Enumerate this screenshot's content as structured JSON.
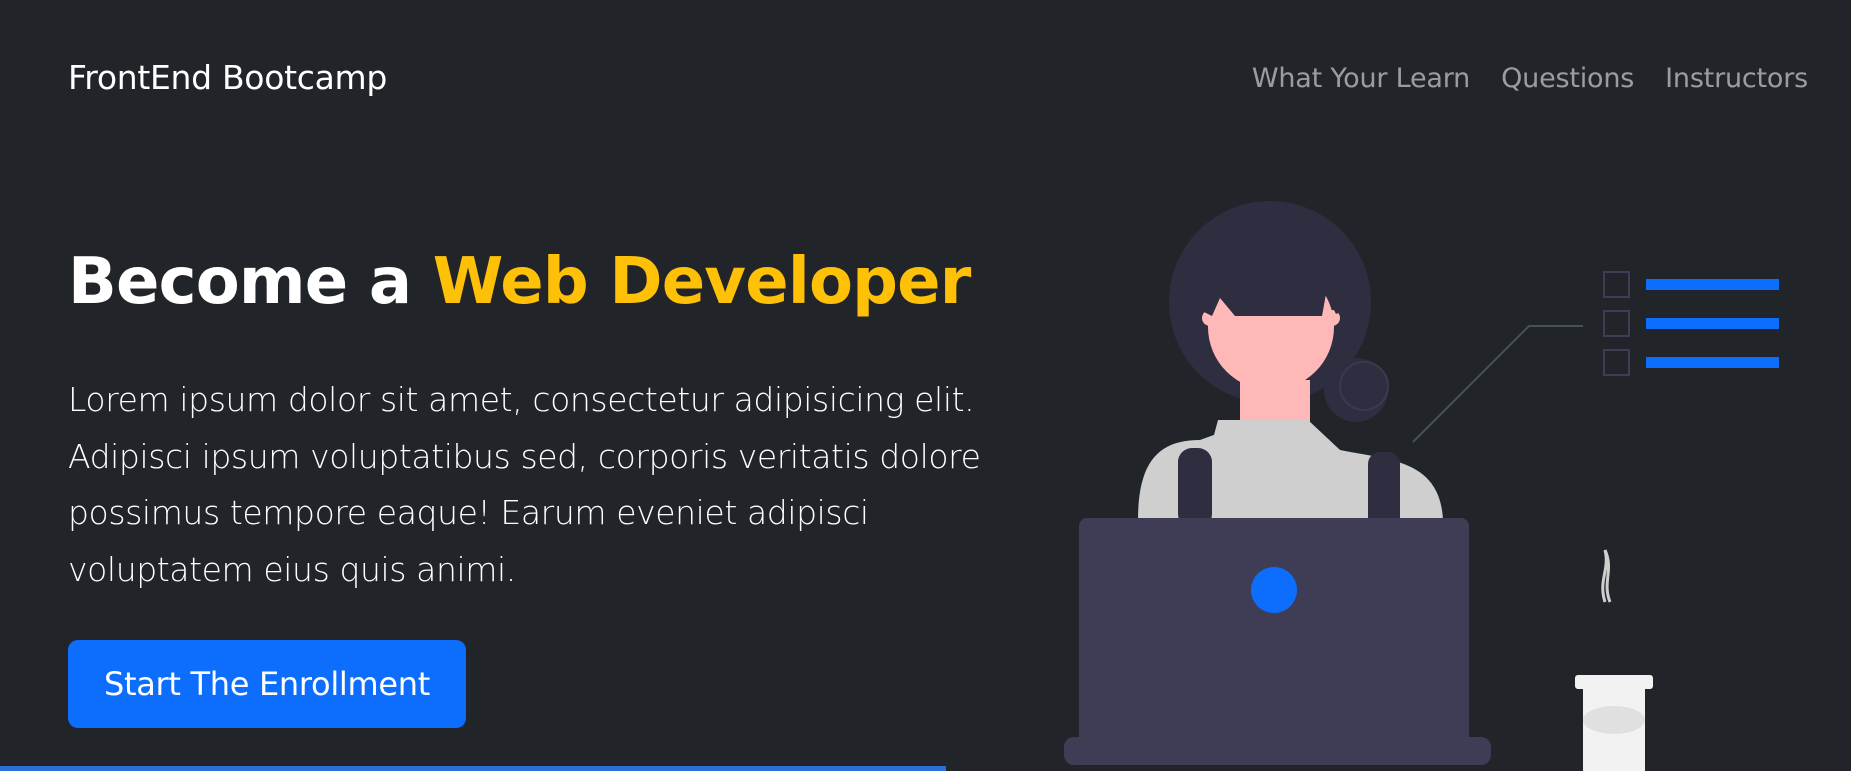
{
  "navbar": {
    "brand": "FrontEnd Bootcamp",
    "links": [
      {
        "label": "What Your Learn"
      },
      {
        "label": "Questions"
      },
      {
        "label": "Instructors"
      }
    ]
  },
  "hero": {
    "headline_start": "Become a ",
    "headline_highlight": "Web Developer",
    "lead_lines": [
      "Lorem ipsum dolor sit amet, consectetur adipisicing elit.",
      "Adipisci ipsum voluptatibus sed, corporis veritatis dolore",
      "possimus tempore eaque! Earum eveniet adipisci",
      "voluptatem eius quis animi."
    ],
    "cta_label": "Start The Enrollment",
    "illustration": "woman-at-laptop-illustration"
  },
  "colors": {
    "background": "#212529",
    "accent_yellow": "#ffc107",
    "primary_blue": "#0d6efd",
    "nav_link": "rgba(255,255,255,0.55)"
  }
}
